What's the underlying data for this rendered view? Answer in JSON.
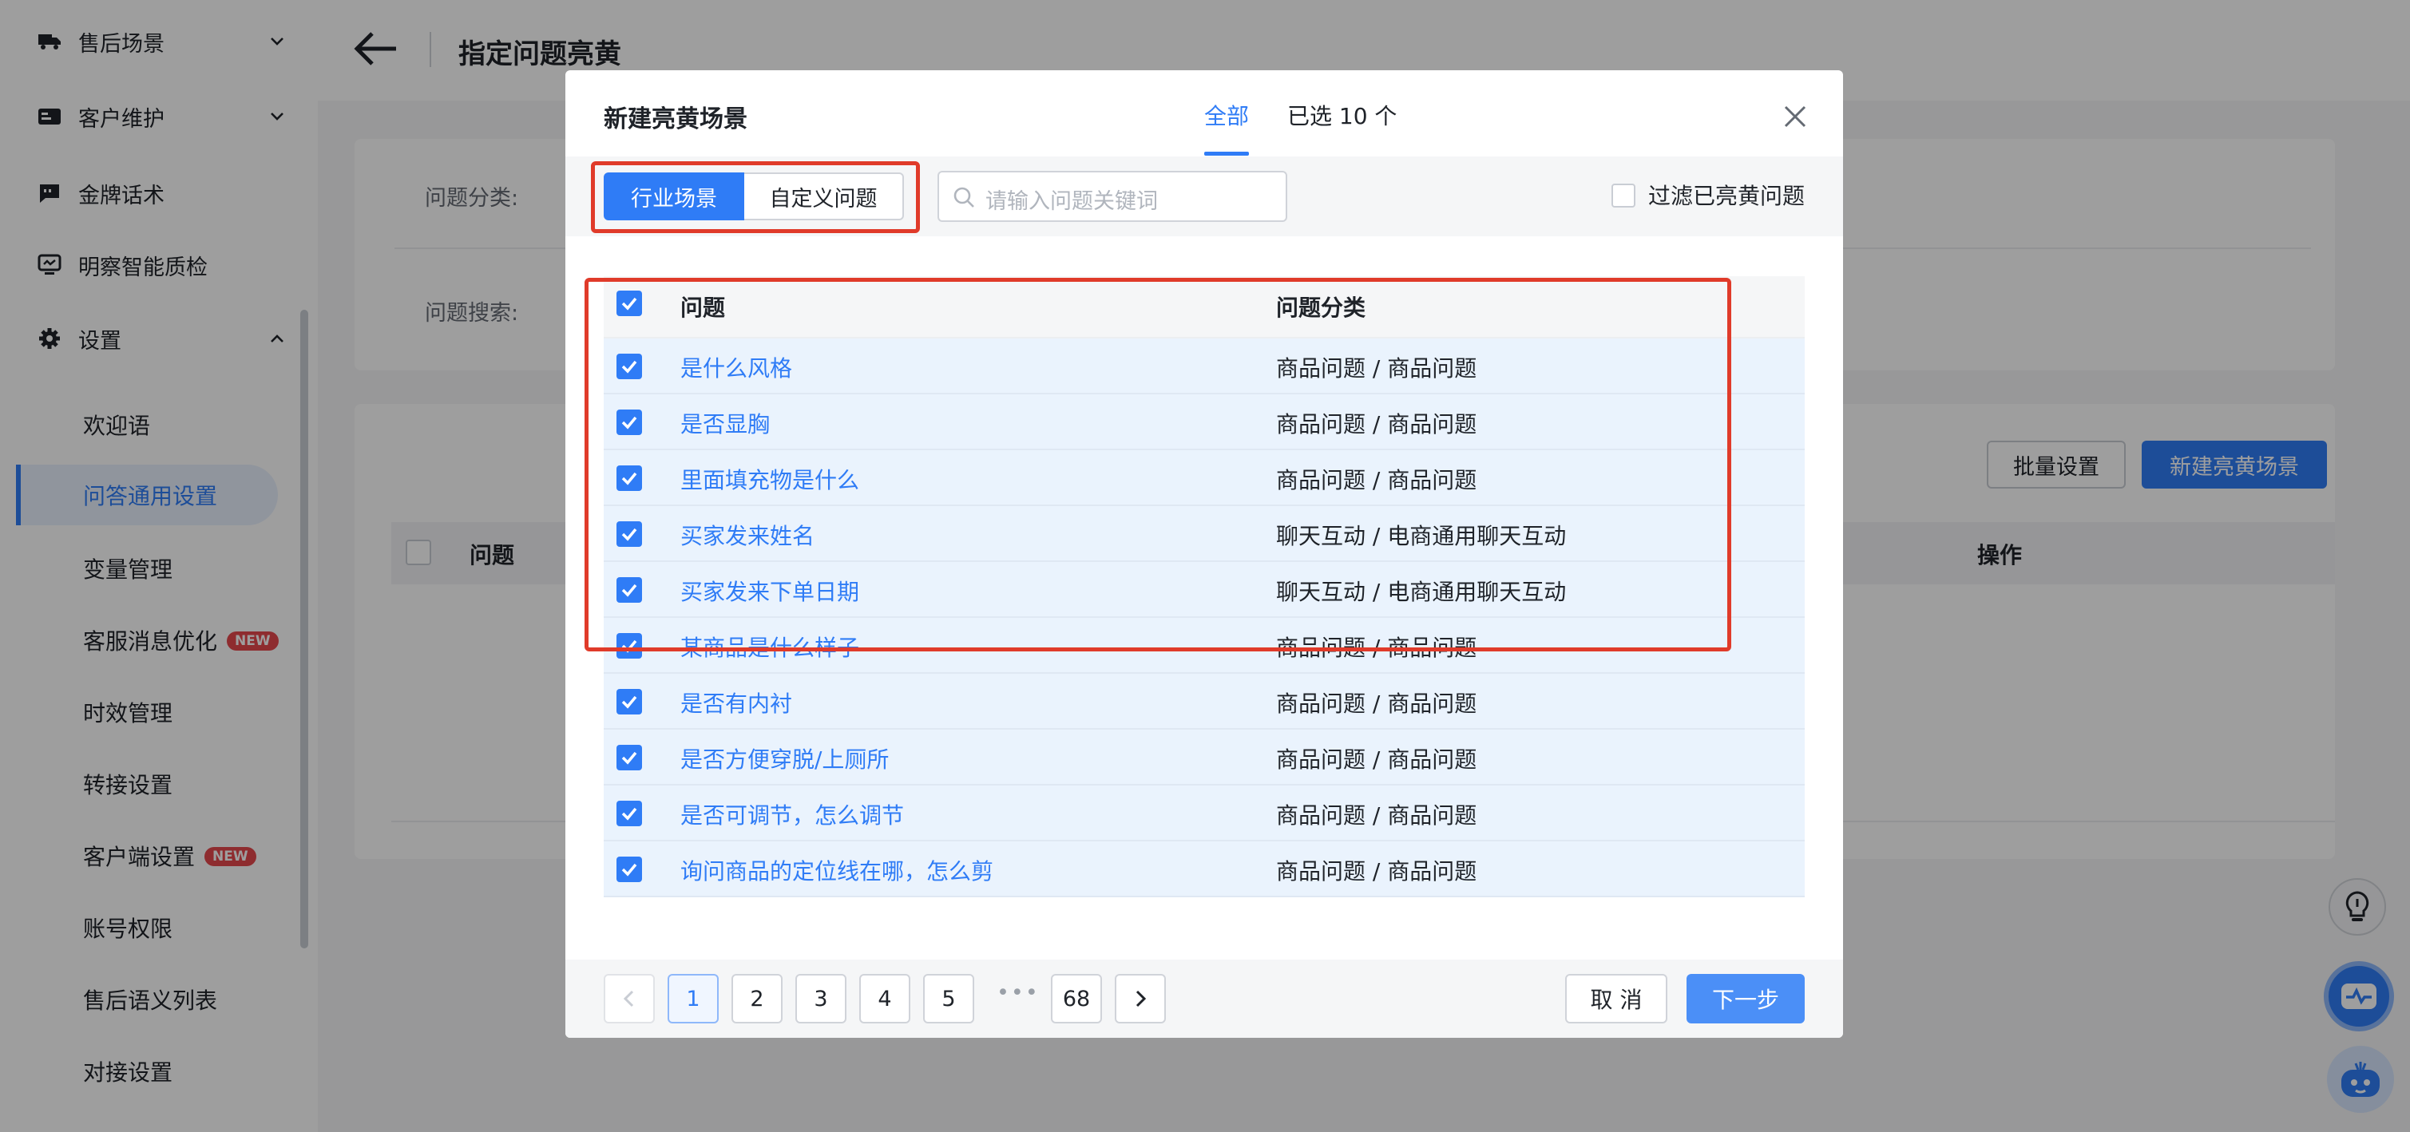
{
  "sidebar": {
    "sections": [
      {
        "label": "售后场景",
        "icon": "truck-icon",
        "expanded": false
      },
      {
        "label": "客户维护",
        "icon": "id-card-icon",
        "expanded": false
      },
      {
        "label": "金牌话术",
        "icon": "chat-icon"
      },
      {
        "label": "明察智能质检",
        "icon": "monitor-icon"
      },
      {
        "label": "设置",
        "icon": "gear-icon",
        "expanded": true
      }
    ],
    "subitems": [
      {
        "label": "欢迎语"
      },
      {
        "label": "问答通用设置",
        "active": true
      },
      {
        "label": "变量管理"
      },
      {
        "label": "客服消息优化",
        "badge": "NEW"
      },
      {
        "label": "时效管理"
      },
      {
        "label": "转接设置"
      },
      {
        "label": "客户端设置",
        "badge": "NEW"
      },
      {
        "label": "账号权限"
      },
      {
        "label": "售后语义列表"
      },
      {
        "label": "对接设置"
      }
    ]
  },
  "page": {
    "title": "指定问题亮黄",
    "filter_category_label": "问题分类:",
    "filter_search_label": "问题搜索:",
    "batch_button": "批量设置",
    "new_scene_button": "新建亮黄场景",
    "table_headers": {
      "question": "问题",
      "action": "操作"
    }
  },
  "modal": {
    "title": "新建亮黄场景",
    "tabs": [
      {
        "label": "全部",
        "active": true
      },
      {
        "label": "已选 10 个",
        "active": false
      }
    ],
    "segments": [
      {
        "label": "行业场景",
        "active": true
      },
      {
        "label": "自定义问题",
        "active": false
      }
    ],
    "search_placeholder": "请输入问题关键词",
    "filter_checkbox_label": "过滤已亮黄问题",
    "filter_checked": false,
    "columns": {
      "question": "问题",
      "category": "问题分类"
    },
    "rows": [
      {
        "question": "是什么风格",
        "category": "商品问题 / 商品问题",
        "checked": true
      },
      {
        "question": "是否显胸",
        "category": "商品问题 / 商品问题",
        "checked": true
      },
      {
        "question": "里面填充物是什么",
        "category": "商品问题 / 商品问题",
        "checked": true
      },
      {
        "question": "买家发来姓名",
        "category": "聊天互动 / 电商通用聊天互动",
        "checked": true
      },
      {
        "question": "买家发来下单日期",
        "category": "聊天互动 / 电商通用聊天互动",
        "checked": true
      },
      {
        "question": "某商品是什么样子",
        "category": "商品问题 / 商品问题",
        "checked": true
      },
      {
        "question": "是否有内衬",
        "category": "商品问题 / 商品问题",
        "checked": true
      },
      {
        "question": "是否方便穿脱/上厕所",
        "category": "商品问题 / 商品问题",
        "checked": true
      },
      {
        "question": "是否可调节，怎么调节",
        "category": "商品问题 / 商品问题",
        "checked": true
      },
      {
        "question": "询问商品的定位线在哪，怎么剪",
        "category": "商品问题 / 商品问题",
        "checked": true
      }
    ],
    "pagination": {
      "pages": [
        "1",
        "2",
        "3",
        "4",
        "5"
      ],
      "current": "1",
      "ellipsis": "•••",
      "last": "68"
    },
    "cancel_button": "取 消",
    "next_button": "下一步"
  },
  "colors": {
    "accent": "#2f7cf6",
    "highlight_box": "#e03b2a",
    "selected_row": "#eaf3fd",
    "new_badge": "#e5484d"
  }
}
